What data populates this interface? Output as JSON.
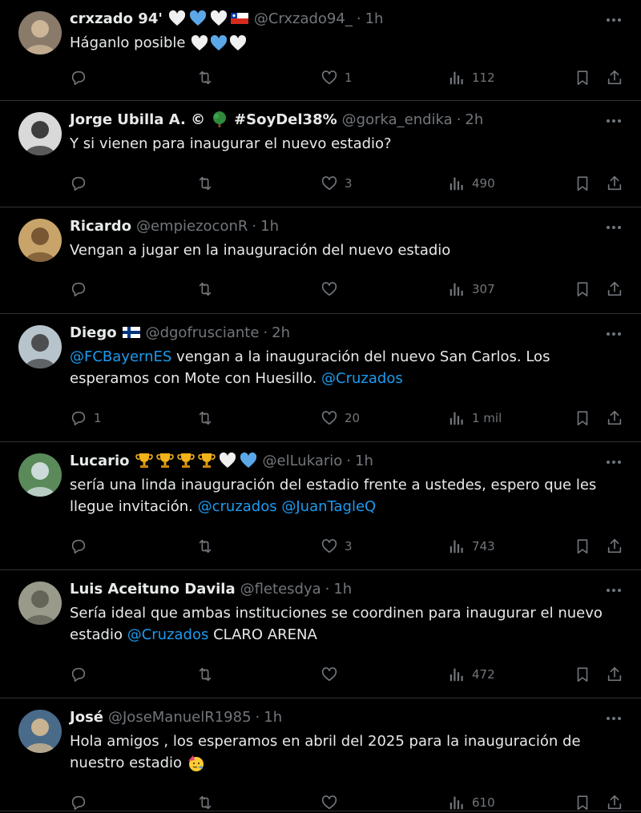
{
  "tweets": [
    {
      "name": "crxzado 94'",
      "emojis": [
        "white-heart",
        "blue-heart",
        "white-heart",
        "chile-flag"
      ],
      "handle": "@Crxzado94_",
      "time": "1h",
      "text": [
        {
          "t": "Háganlo posible "
        },
        {
          "emoji": [
            "white-heart",
            "blue-heart",
            "white-heart"
          ]
        }
      ],
      "replies": "",
      "retweets": "",
      "likes": "1",
      "views": "112",
      "avatar": {
        "bg": "#8a7a6a",
        "fg": "#d8c0a0"
      }
    },
    {
      "name": "Jorge Ubilla A. ©",
      "emojis": [
        "tree"
      ],
      "name_suffix": "#SoyDel38%",
      "handle": "@gorka_endika",
      "time": "2h",
      "text": [
        {
          "t": "Y si vienen para inaugurar el nuevo estadio?"
        }
      ],
      "replies": "",
      "retweets": "",
      "likes": "3",
      "views": "490",
      "avatar": {
        "bg": "#d9d9d9",
        "fg": "#222"
      }
    },
    {
      "name": "Ricardo",
      "emojis": [],
      "handle": "@empiezoconR",
      "time": "1h",
      "text": [
        {
          "t": "Vengan a jugar en la inauguración del nuevo estadio"
        }
      ],
      "replies": "",
      "retweets": "",
      "likes": "",
      "views": "307",
      "avatar": {
        "bg": "#c9a46a",
        "fg": "#6b4a2a"
      }
    },
    {
      "name": "Diego",
      "emojis": [
        "finland-flag"
      ],
      "handle": "@dgofrusciante",
      "time": "2h",
      "text": [
        {
          "link": "@FCBayernES"
        },
        {
          "t": " vengan a la inauguración del nuevo San Carlos. Los esperamos con Mote con Huesillo. "
        },
        {
          "link": "@Cruzados"
        }
      ],
      "replies": "1",
      "retweets": "",
      "likes": "20",
      "views": "1 mil",
      "avatar": {
        "bg": "#b8c4cc",
        "fg": "#3a3a3a"
      }
    },
    {
      "name": "Lucario",
      "emojis": [
        "trophy",
        "trophy",
        "trophy",
        "trophy",
        "white-heart",
        "blue-heart"
      ],
      "handle": "@elLukario",
      "time": "1h",
      "text": [
        {
          "t": "sería una linda inauguración del estadio frente a ustedes, espero que les llegue invitación. "
        },
        {
          "link": "@cruzados"
        },
        {
          "t": " "
        },
        {
          "link": "@JuanTagleQ"
        }
      ],
      "replies": "",
      "retweets": "",
      "likes": "3",
      "views": "743",
      "avatar": {
        "bg": "#5a8a5a",
        "fg": "#e0e8f0"
      }
    },
    {
      "name": "Luis Aceituno Davila",
      "emojis": [],
      "handle": "@fletesdya",
      "time": "1h",
      "text": [
        {
          "t": "Sería ideal que ambas instituciones se coordinen para inaugurar el nuevo estadio "
        },
        {
          "link": "@Cruzados"
        },
        {
          "t": " CLARO ARENA"
        }
      ],
      "replies": "",
      "retweets": "",
      "likes": "",
      "views": "472",
      "avatar": {
        "bg": "#9a9a8a",
        "fg": "#5a5a50"
      }
    },
    {
      "name": "José",
      "emojis": [],
      "handle": "@JoseManuelR1985",
      "time": "1h",
      "text": [
        {
          "t": "Hola amigos , los esperamos en abril del 2025 para la inauguración de nuestro estadio "
        },
        {
          "emoji": [
            "party-face"
          ]
        }
      ],
      "replies": "",
      "retweets": "",
      "likes": "",
      "views": "610",
      "avatar": {
        "bg": "#4a6a8a",
        "fg": "#e0c090"
      }
    }
  ],
  "colors": {
    "background": "#000000",
    "text": "#e7e9ea",
    "muted": "#71767b",
    "link": "#1d9bf0",
    "divider": "#2f3336",
    "blue_heart": "#5ba8e8"
  },
  "icons": {
    "reply": "reply-icon",
    "retweet": "retweet-icon",
    "like": "heart-icon",
    "views": "views-chart-icon",
    "bookmark": "bookmark-icon",
    "share": "share-icon",
    "more": "more-dots-icon"
  }
}
